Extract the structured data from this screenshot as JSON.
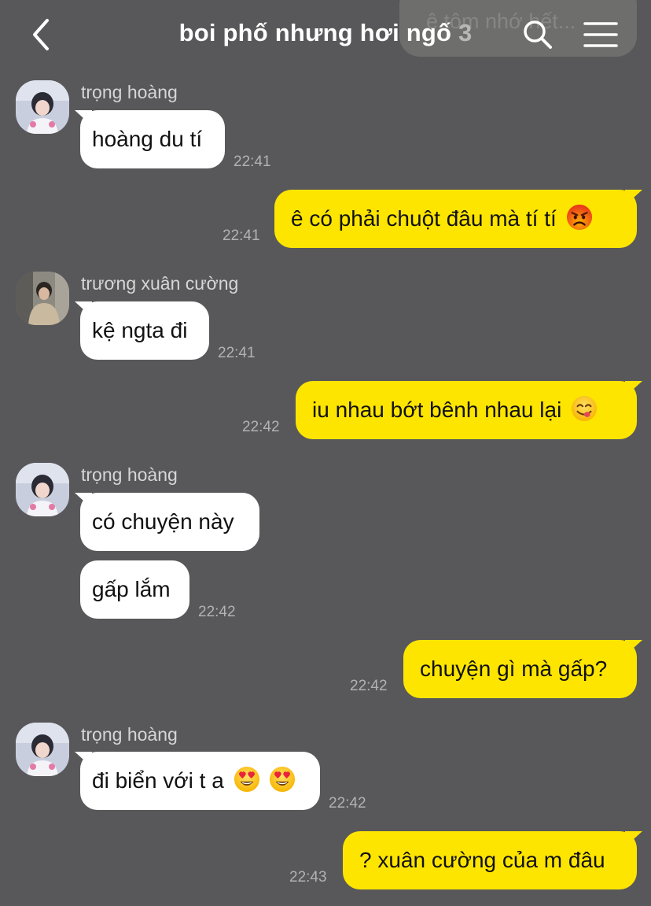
{
  "header": {
    "title": "boi phố nhưng hơi ngố",
    "member_count": "3",
    "ghost_text": "ê tôm nhớ hết..."
  },
  "colors": {
    "background": "#58585a",
    "incoming_bubble": "#ffffff",
    "outgoing_bubble": "#fee500",
    "timestamp": "#b2b2b2",
    "name": "#d6d6d6"
  },
  "icons": {
    "back": "chevron-left-icon",
    "search": "search-icon",
    "menu": "hamburger-menu-icon",
    "angry": "angry-face-emoji",
    "yum": "yum-face-emoji",
    "heart_eyes": "heart-eyes-emoji"
  },
  "messages": [
    {
      "sender": "trọng hoàng",
      "text": "hoàng du tí",
      "time": "22:41",
      "direction": "in"
    },
    {
      "sender": "me",
      "text": "ê có phải chuột đâu mà tí tí",
      "emoji": "angry",
      "time": "22:41",
      "direction": "out"
    },
    {
      "sender": "trương xuân cường",
      "text": "kệ ngta đi",
      "time": "22:41",
      "direction": "in"
    },
    {
      "sender": "me",
      "text": "iu nhau bớt bênh nhau lại",
      "emoji": "yum",
      "time": "22:42",
      "direction": "out"
    },
    {
      "sender": "trọng hoàng",
      "text": "có chuyện này",
      "direction": "in"
    },
    {
      "sender": "trọng hoàng",
      "text": "gấp lắm",
      "time": "22:42",
      "direction": "in"
    },
    {
      "sender": "me",
      "text": "chuyện gì mà gấp?",
      "time": "22:42",
      "direction": "out"
    },
    {
      "sender": "trọng hoàng",
      "text": "đi biển với t a",
      "emoji": "heart_eyes x2",
      "time": "22:42",
      "direction": "in"
    },
    {
      "sender": "me",
      "text": "? xuân cường của m đâu",
      "time": "22:43",
      "direction": "out"
    }
  ]
}
